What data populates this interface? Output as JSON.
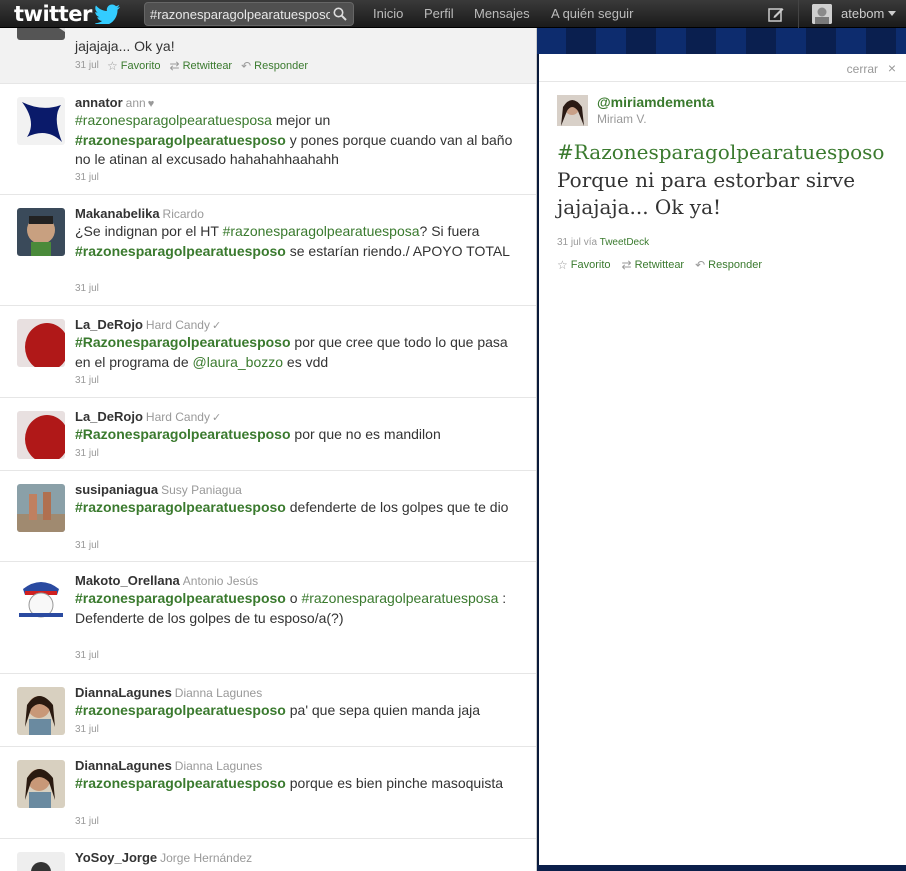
{
  "topbar": {
    "logo_text": "twitter",
    "search_value": "#razonesparagolpearatuesposo",
    "nav": [
      "Inicio",
      "Perfil",
      "Mensajes",
      "A quién seguir"
    ],
    "user": "atebom"
  },
  "timeline": {
    "tweets": [
      {
        "text_tail": "jajajaja... Ok ya!",
        "date": "31 jul",
        "actions": {
          "favorite": "Favorito",
          "retweet": "Retwittear",
          "reply": "Responder"
        }
      },
      {
        "user": "annator",
        "real": "ann",
        "mark": "♥",
        "parts": [
          {
            "t": "#razonesparagolpearatuesposa",
            "c": "tag"
          },
          {
            "t": " mejor un ",
            "c": ""
          },
          {
            "t": "#razonesparagolpearatuesposo",
            "c": "tag-b"
          },
          {
            "t": " y pones porque cuando van al baño no le atinan al excusado hahahahhaahahh",
            "c": ""
          }
        ],
        "date": "31 jul"
      },
      {
        "user": "Makanabelika",
        "real": "Ricardo",
        "mark": "",
        "parts": [
          {
            "t": "¿Se indignan por el HT ",
            "c": ""
          },
          {
            "t": "#razonesparagolpearatuesposa",
            "c": "tag"
          },
          {
            "t": "? Si fuera ",
            "c": ""
          },
          {
            "t": "#razonesparagolpearatuesposo",
            "c": "tag-b"
          },
          {
            "t": " se estarían riendo./ APOYO TOTAL",
            "c": ""
          }
        ],
        "date": "31 jul"
      },
      {
        "user": "La_DeRojo",
        "real": "Hard Candy",
        "mark": "✓",
        "parts": [
          {
            "t": "#Razonesparagolpearatuesposo",
            "c": "tag-b"
          },
          {
            "t": " por que cree que todo lo que pasa en el programa de ",
            "c": ""
          },
          {
            "t": "@laura_bozzo",
            "c": "mention"
          },
          {
            "t": " es vdd",
            "c": ""
          }
        ],
        "date": "31 jul"
      },
      {
        "user": "La_DeRojo",
        "real": "Hard Candy",
        "mark": "✓",
        "parts": [
          {
            "t": "#Razonesparagolpearatuesposo",
            "c": "tag-b"
          },
          {
            "t": " por que no es mandilon",
            "c": ""
          }
        ],
        "date": "31 jul"
      },
      {
        "user": "susipaniagua",
        "real": "Susy Paniagua",
        "mark": "",
        "parts": [
          {
            "t": "#razonesparagolpearatuesposo",
            "c": "tag-b"
          },
          {
            "t": " defenderte de los golpes que te dio",
            "c": ""
          }
        ],
        "date": "31 jul"
      },
      {
        "user": "Makoto_Orellana",
        "real": "Antonio Jesús",
        "mark": "",
        "parts": [
          {
            "t": "#razonesparagolpearatuesposo",
            "c": "tag-b"
          },
          {
            "t": " o ",
            "c": ""
          },
          {
            "t": "#razonesparagolpearatuesposa",
            "c": "tag"
          },
          {
            "t": " : Defenderte de los golpes de tu esposo/a(?)",
            "c": ""
          }
        ],
        "date": "31 jul"
      },
      {
        "user": "DiannaLagunes",
        "real": "Dianna Lagunes",
        "mark": "",
        "parts": [
          {
            "t": "#razonesparagolpearatuesposo",
            "c": "tag-b"
          },
          {
            "t": " pa' que sepa quien manda jaja",
            "c": ""
          }
        ],
        "date": "31 jul"
      },
      {
        "user": "DiannaLagunes",
        "real": "Dianna Lagunes",
        "mark": "",
        "parts": [
          {
            "t": "#razonesparagolpearatuesposo",
            "c": "tag-b"
          },
          {
            "t": " porque es bien pinche masoquista",
            "c": ""
          }
        ],
        "date": "31 jul"
      },
      {
        "user": "YoSoy_Jorge",
        "real": "Jorge Hernández",
        "mark": "",
        "parts": [],
        "date": ""
      }
    ]
  },
  "detail": {
    "close": "cerrar",
    "user": "@miriamdementa",
    "real": "Miriam V.",
    "hashtag": "#Razonesparagolpearatuesposo",
    "text": "Porque ni para estorbar sirve jajajaja... Ok ya!",
    "date": "31 jul",
    "via_label": "vía",
    "via": "TweetDeck",
    "actions": {
      "favorite": "Favorito",
      "retweet": "Retwittear",
      "reply": "Responder"
    }
  },
  "colors": {
    "link": "#3a7a2e",
    "topbar": "#222222"
  }
}
